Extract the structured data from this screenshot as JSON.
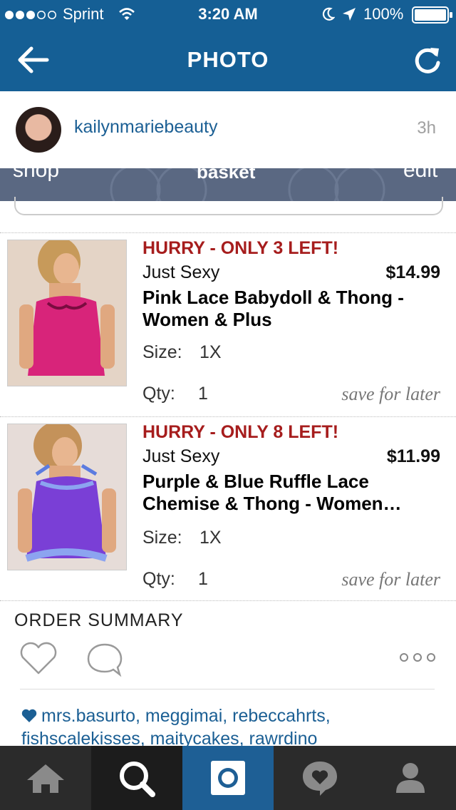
{
  "status_bar": {
    "carrier": "Sprint",
    "time": "3:20 AM",
    "battery": "100%"
  },
  "nav": {
    "title": "PHOTO"
  },
  "post": {
    "username": "kailynmariebeauty",
    "time_ago": "3h"
  },
  "shop_nav": {
    "items": [
      "shop",
      "basket",
      "edit"
    ]
  },
  "products": [
    {
      "hurry": "HURRY - ONLY 3 LEFT!",
      "brand": "Just Sexy",
      "price": "$14.99",
      "name_line1": "Pink Lace Babydoll & Thong -",
      "name_line2": "Women & Plus",
      "size_label": "Size:",
      "size_value": "1X",
      "qty_label": "Qty:",
      "qty_value": "1",
      "save_label": "save for later",
      "color": "#d8247a"
    },
    {
      "hurry": "HURRY - ONLY 8 LEFT!",
      "brand": "Just Sexy",
      "price": "$11.99",
      "name_line1": "Purple & Blue Ruffle Lace",
      "name_line2": "Chemise & Thong - Women…",
      "size_label": "Size:",
      "size_value": "1X",
      "qty_label": "Qty:",
      "qty_value": "1",
      "save_label": "save for later",
      "color": "#7a3fd6"
    }
  ],
  "order_summary": "ORDER SUMMARY",
  "likers": {
    "line1": "mrs.basurto, meggimai, rebeccahrts,",
    "line2": "fishscalekisses, maitycakes, rawrdino"
  },
  "colors": {
    "brand_blue": "#155f95",
    "hurry_red": "#a61d1d",
    "tab_bar": "#2b2b2b"
  },
  "icons": {
    "back": "back-arrow-icon",
    "refresh": "refresh-icon",
    "like": "heart-icon",
    "comment": "comment-icon",
    "more": "more-icon",
    "tabs": [
      "home-icon",
      "search-icon",
      "camera-icon",
      "activity-icon",
      "profile-icon"
    ]
  }
}
